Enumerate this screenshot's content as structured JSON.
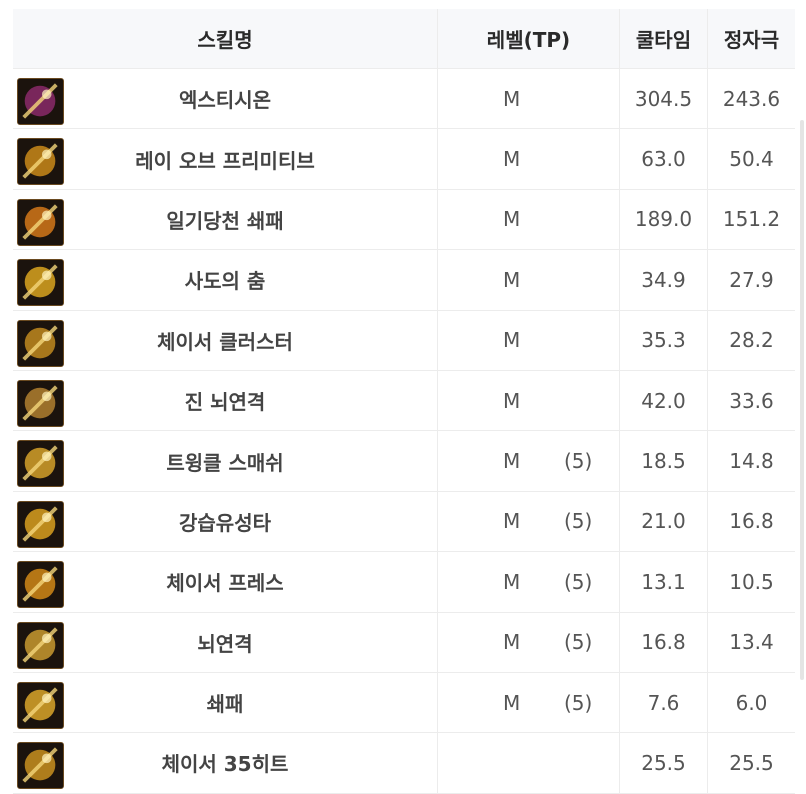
{
  "header": {
    "name": "스킬명",
    "level": "레벨(TP)",
    "cooldown": "쿨타임",
    "fixed": "정자극"
  },
  "rows": [
    {
      "name": "엑스티시온",
      "level": "M",
      "tp": "",
      "cool": "304.5",
      "fixed": "243.6",
      "icon": "ecstasion-icon",
      "color": "#8a2a6a"
    },
    {
      "name": "레이 오브 프리미티브",
      "level": "M",
      "tp": "",
      "cool": "63.0",
      "fixed": "50.4",
      "icon": "ray-of-primitive-icon",
      "color": "#c98a1a"
    },
    {
      "name": "일기당천 쇄패",
      "level": "M",
      "tp": "",
      "cool": "189.0",
      "fixed": "151.2",
      "icon": "ilgidangcheon-icon",
      "color": "#d2781a"
    },
    {
      "name": "사도의 춤",
      "level": "M",
      "tp": "",
      "cool": "34.9",
      "fixed": "27.9",
      "icon": "apostle-dance-icon",
      "color": "#d9a520"
    },
    {
      "name": "체이서 클러스터",
      "level": "M",
      "tp": "",
      "cool": "35.3",
      "fixed": "28.2",
      "icon": "chaser-cluster-icon",
      "color": "#c08a20"
    },
    {
      "name": "진 뇌연격",
      "level": "M",
      "tp": "",
      "cool": "42.0",
      "fixed": "33.6",
      "icon": "jin-noeyeongyeok-icon",
      "color": "#b08030"
    },
    {
      "name": "트윙클 스매쉬",
      "level": "M",
      "tp": "(5)",
      "cool": "18.5",
      "fixed": "14.8",
      "icon": "twinkle-smash-icon",
      "color": "#d4a12a"
    },
    {
      "name": "강습유성타",
      "level": "M",
      "tp": "(5)",
      "cool": "21.0",
      "fixed": "16.8",
      "icon": "gangseup-icon",
      "color": "#d8a020"
    },
    {
      "name": "체이서 프레스",
      "level": "M",
      "tp": "(5)",
      "cool": "13.1",
      "fixed": "10.5",
      "icon": "chaser-press-icon",
      "color": "#d08818"
    },
    {
      "name": "뇌연격",
      "level": "M",
      "tp": "(5)",
      "cool": "16.8",
      "fixed": "13.4",
      "icon": "noeyeongyeok-icon",
      "color": "#c89a30"
    },
    {
      "name": "쇄패",
      "level": "M",
      "tp": "(5)",
      "cool": "7.6",
      "fixed": "6.0",
      "icon": "swaepae-icon",
      "color": "#d9a62a"
    },
    {
      "name": "체이서 35히트",
      "level": "",
      "tp": "",
      "cool": "25.5",
      "fixed": "25.5",
      "icon": "chaser-35hit-icon",
      "color": "#c89020"
    }
  ]
}
